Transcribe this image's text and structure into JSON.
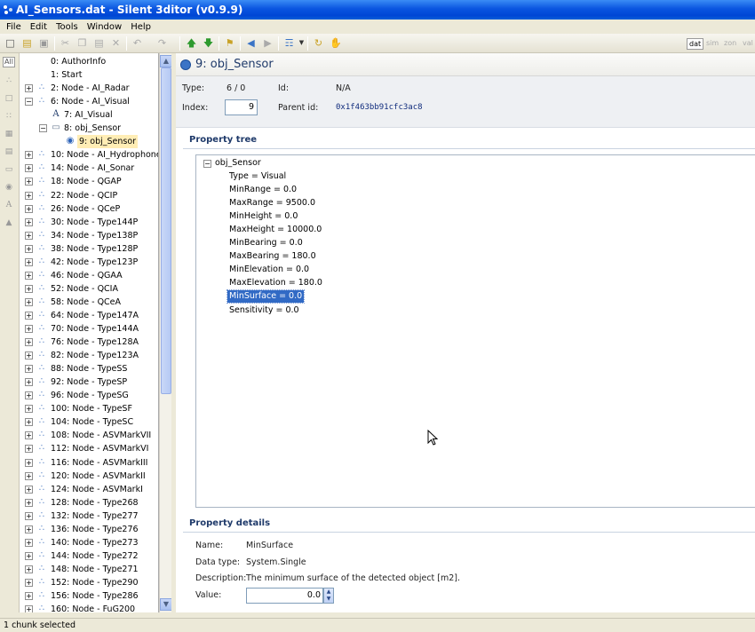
{
  "window": {
    "title": "AI_Sensors.dat - Silent 3ditor (v0.9.9)"
  },
  "menu": [
    "File",
    "Edit",
    "Tools",
    "Window",
    "Help"
  ],
  "modes": [
    "dat",
    "sim",
    "zon",
    "val"
  ],
  "left_filter": "All",
  "tree": {
    "items": [
      {
        "label": "0: AuthorInfo",
        "level": 1,
        "expander": "",
        "icon": ""
      },
      {
        "label": "1: Start",
        "level": 1,
        "expander": "",
        "icon": ""
      },
      {
        "label": "2: Node - AI_Radar",
        "level": 0,
        "expander": "+",
        "icon": "node"
      },
      {
        "label": "6: Node - AI_Visual",
        "level": 0,
        "expander": "-",
        "icon": "node"
      },
      {
        "label": "7: AI_Visual",
        "level": 1,
        "expander": "",
        "icon": "A"
      },
      {
        "label": "8: obj_Sensor",
        "level": 1,
        "expander": "-",
        "icon": "doc"
      },
      {
        "label": "9: obj_Sensor",
        "level": 2,
        "expander": "",
        "icon": "globe",
        "selected": true
      },
      {
        "label": "10: Node - AI_Hydrophone",
        "level": 0,
        "expander": "+",
        "icon": "node"
      },
      {
        "label": "14: Node - AI_Sonar",
        "level": 0,
        "expander": "+",
        "icon": "node"
      },
      {
        "label": "18: Node - QGAP",
        "level": 0,
        "expander": "+",
        "icon": "node"
      },
      {
        "label": "22: Node - QCIP",
        "level": 0,
        "expander": "+",
        "icon": "node"
      },
      {
        "label": "26: Node - QCeP",
        "level": 0,
        "expander": "+",
        "icon": "node"
      },
      {
        "label": "30: Node - Type144P",
        "level": 0,
        "expander": "+",
        "icon": "node"
      },
      {
        "label": "34: Node - Type138P",
        "level": 0,
        "expander": "+",
        "icon": "node"
      },
      {
        "label": "38: Node - Type128P",
        "level": 0,
        "expander": "+",
        "icon": "node"
      },
      {
        "label": "42: Node - Type123P",
        "level": 0,
        "expander": "+",
        "icon": "node"
      },
      {
        "label": "46: Node - QGAA",
        "level": 0,
        "expander": "+",
        "icon": "node"
      },
      {
        "label": "52: Node - QCIA",
        "level": 0,
        "expander": "+",
        "icon": "node"
      },
      {
        "label": "58: Node - QCeA",
        "level": 0,
        "expander": "+",
        "icon": "node"
      },
      {
        "label": "64: Node - Type147A",
        "level": 0,
        "expander": "+",
        "icon": "node"
      },
      {
        "label": "70: Node - Type144A",
        "level": 0,
        "expander": "+",
        "icon": "node"
      },
      {
        "label": "76: Node - Type128A",
        "level": 0,
        "expander": "+",
        "icon": "node"
      },
      {
        "label": "82: Node - Type123A",
        "level": 0,
        "expander": "+",
        "icon": "node"
      },
      {
        "label": "88: Node - TypeSS",
        "level": 0,
        "expander": "+",
        "icon": "node"
      },
      {
        "label": "92: Node - TypeSP",
        "level": 0,
        "expander": "+",
        "icon": "node"
      },
      {
        "label": "96: Node - TypeSG",
        "level": 0,
        "expander": "+",
        "icon": "node"
      },
      {
        "label": "100: Node - TypeSF",
        "level": 0,
        "expander": "+",
        "icon": "node"
      },
      {
        "label": "104: Node - TypeSC",
        "level": 0,
        "expander": "+",
        "icon": "node"
      },
      {
        "label": "108: Node - ASVMarkVII",
        "level": 0,
        "expander": "+",
        "icon": "node"
      },
      {
        "label": "112: Node - ASVMarkVI",
        "level": 0,
        "expander": "+",
        "icon": "node"
      },
      {
        "label": "116: Node - ASVMarkIII",
        "level": 0,
        "expander": "+",
        "icon": "node"
      },
      {
        "label": "120: Node - ASVMarkII",
        "level": 0,
        "expander": "+",
        "icon": "node"
      },
      {
        "label": "124: Node - ASVMarkI",
        "level": 0,
        "expander": "+",
        "icon": "node"
      },
      {
        "label": "128: Node - Type268",
        "level": 0,
        "expander": "+",
        "icon": "node"
      },
      {
        "label": "132: Node - Type277",
        "level": 0,
        "expander": "+",
        "icon": "node"
      },
      {
        "label": "136: Node - Type276",
        "level": 0,
        "expander": "+",
        "icon": "node"
      },
      {
        "label": "140: Node - Type273",
        "level": 0,
        "expander": "+",
        "icon": "node"
      },
      {
        "label": "144: Node - Type272",
        "level": 0,
        "expander": "+",
        "icon": "node"
      },
      {
        "label": "148: Node - Type271",
        "level": 0,
        "expander": "+",
        "icon": "node"
      },
      {
        "label": "152: Node - Type290",
        "level": 0,
        "expander": "+",
        "icon": "node"
      },
      {
        "label": "156: Node - Type286",
        "level": 0,
        "expander": "+",
        "icon": "node"
      },
      {
        "label": "160: Node - FuG200",
        "level": 0,
        "expander": "+",
        "icon": "node"
      }
    ]
  },
  "chunk": {
    "title": "9: obj_Sensor",
    "type_label": "Type:",
    "type_value": "6 / 0",
    "id_label": "Id:",
    "id_value": "N/A",
    "index_label": "Index:",
    "index_value": "9",
    "parent_label": "Parent id:",
    "parent_value": "0x1f463bb91cfc3ac8"
  },
  "property_tree": {
    "heading": "Property tree",
    "root": "obj_Sensor",
    "props": [
      "Type = Visual",
      "MinRange = 0.0",
      "MaxRange = 9500.0",
      "MinHeight = 0.0",
      "MaxHeight = 10000.0",
      "MinBearing = 0.0",
      "MaxBearing = 180.0",
      "MinElevation = 0.0",
      "MaxElevation = 180.0",
      "MinSurface = 0.0",
      "Sensitivity = 0.0"
    ],
    "selected_index": 9
  },
  "details": {
    "heading": "Property details",
    "name_label": "Name:",
    "name_value": "MinSurface",
    "type_label": "Data type:",
    "type_value": "System.Single",
    "desc_label": "Description:",
    "desc_value": "The minimum surface of the detected object [m2].",
    "value_label": "Value:",
    "value_value": "0.0"
  },
  "status": "1 chunk selected"
}
